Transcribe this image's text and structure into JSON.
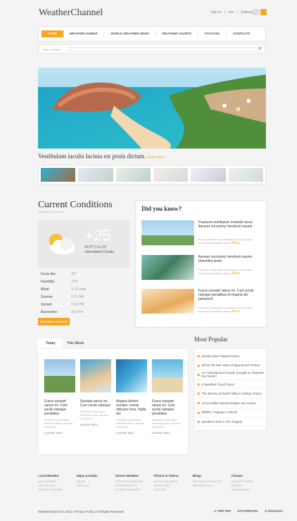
{
  "header": {
    "logo": "WeatherChannel",
    "links": [
      "Sign In",
      "Join",
      "Settings"
    ]
  },
  "nav": [
    "HOME",
    "WEATHER GUIDES",
    "WORLD WEATHER NEWS",
    "WEATHER CHARTS",
    "FOOTAGE",
    "CONTACTS"
  ],
  "search": {
    "label": "Enter Location"
  },
  "hero": {
    "caption": "Vestibulum iaculis lacinia est proin dictum.",
    "more": "Read More"
  },
  "current": {
    "title": "Current Conditions",
    "date": "Wed 18, 8:15 am CE",
    "temp": "+25",
    "hilo": "Hi 27° | Lo 21°",
    "summary": "Intermittent Clouds",
    "rows": [
      {
        "k": "Feels like:",
        "v": "26°"
      },
      {
        "k": "Humidity:",
        "v": "71%"
      },
      {
        "k": "Wind:",
        "v": "S 16 mph"
      },
      {
        "k": "Sunrise:",
        "v": "6:31 AM"
      },
      {
        "k": "Sunset:",
        "v": "6:52 PM"
      },
      {
        "k": "Barometer:",
        "v": "30.07 in"
      }
    ],
    "button": "CHANGE LOCATION"
  },
  "didyouknow": {
    "title": "Did you know?",
    "items": [
      {
        "title": "Praesent vestibulum molestie lacus. Aenean nonummy hendrerit mauris",
        "text": "Praesent vestibulum molestie lacus. Aenean nonummy hendrerit mauris",
        "more": "More"
      },
      {
        "title": "Aenean nonummy hendrerit mauris phasellus porta",
        "text": "Praesent vestibulum molestie lacus. Aenean nonummy hendrerit mauris",
        "more": "More"
      },
      {
        "title": "Fusce suscipit varius mi. Cum sociis natoque penatibus et magnis dis parturient",
        "text": "Praesent vestibulum molestie lacus. Aenean nonummy hendrerit mauris",
        "more": "More"
      }
    ]
  },
  "tabs": [
    "Today",
    "This Week"
  ],
  "cards": [
    {
      "title": "Fusce suscipit varius mi. Cum sociis natoque penatibus",
      "text": "Praesent vestibulum molestie lacus. Aenean nonummy",
      "more": "MORE INFO"
    },
    {
      "title": "Suscipit varius mi. Cum sociis natoque",
      "text": "Praesent vestibulum molestie lacus. Aenean nonummy",
      "more": "MORE INFO"
    },
    {
      "title": "Magnis dislent montes, nectar ridiculus mus. Nulla dui",
      "text": "Praesent vestibulum molestie lacus. Aenean nonummy",
      "more": "MORE INFO"
    },
    {
      "title": "Fusce suscipit varius mi. Cum sociis natoque penatibus",
      "text": "Praesent vestibulum molestie lacus. Aenean nonummy",
      "more": "MORE INFO"
    }
  ],
  "popular": {
    "title": "Most Popular",
    "items": [
      "World's Most Polluted Rivers",
      "Before the Ban: Rare Vintage Beach Photos",
      "Are Simultaneous Floods, Drought on Opposite the Pacific?",
      "6 Deadliest Cloud Travel",
      "The Mystery of Death Valley's 'Sailing' Stones",
      "10 Incredible Natural Bridges and Arches",
      "Wildfire: Tragedy in Yarnell",
      "Weather's Role in Tire Tragedy"
    ]
  },
  "footer": {
    "cols": [
      {
        "h": "Local Weather",
        "l": [
          "WEB CAMERAS",
          "HISTORY DATA",
          "WEATHER CHANNEL"
        ]
      },
      {
        "h": "Maps & Radar",
        "l": [
          "RADAR",
          "SATELLITE"
        ]
      },
      {
        "h": "Severe Weather",
        "l": [
          "TROPICAL HURRICANE",
          "STORM REPORTS",
          "EXTREME WEATHER"
        ]
      },
      {
        "h": "Photos & Videos",
        "l": [
          "PHOTO GALLERIES",
          "WORLD VIDS",
          "FOOTAGE"
        ]
      },
      {
        "h": "Blogs",
        "l": [
          "METEOROLOGY BLOGS",
          "MEMBER BLOGS"
        ]
      },
      {
        "h": "Climate",
        "l": [
          "CLIMATE CHANGE",
          "SCIENCE",
          "ENVIRONMENT"
        ]
      }
    ],
    "copy": "WeatherChannel © 2013 | Privacy Policy | All Rights Reserved",
    "social": [
      "TWITTER",
      "FACEBOOK",
      "GOOGLE+"
    ]
  }
}
